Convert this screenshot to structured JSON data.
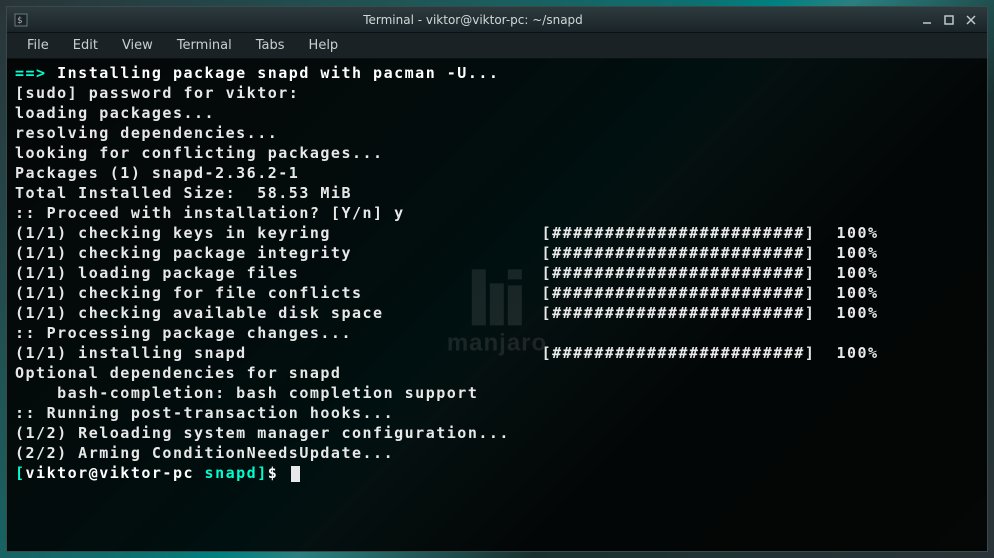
{
  "window": {
    "title": "Terminal - viktor@viktor-pc: ~/snapd"
  },
  "menubar": {
    "items": [
      "File",
      "Edit",
      "View",
      "Terminal",
      "Tabs",
      "Help"
    ]
  },
  "watermark": {
    "text": "manjaro"
  },
  "terminal": {
    "arrow": "==> ",
    "install_heading": "Installing package snapd with pacman -U...",
    "lines": [
      "[sudo] password for viktor:",
      "loading packages...",
      "resolving dependencies...",
      "looking for conflicting packages...",
      "",
      "Packages (1) snapd-2.36.2-1",
      "",
      "Total Installed Size:  58.53 MiB",
      "",
      ":: Proceed with installation? [Y/n] y"
    ],
    "progress": [
      {
        "label": "(1/1) checking keys in keyring",
        "pct": "100%"
      },
      {
        "label": "(1/1) checking package integrity",
        "pct": "100%"
      },
      {
        "label": "(1/1) loading package files",
        "pct": "100%"
      },
      {
        "label": "(1/1) checking for file conflicts",
        "pct": "100%"
      },
      {
        "label": "(1/1) checking available disk space",
        "pct": "100%"
      }
    ],
    "processing": ":: Processing package changes...",
    "install_progress": {
      "label": "(1/1) installing snapd",
      "pct": "100%"
    },
    "post": [
      "Optional dependencies for snapd",
      "    bash-completion: bash completion support",
      ":: Running post-transaction hooks...",
      "(1/2) Reloading system manager configuration...",
      "(2/2) Arming ConditionNeedsUpdate..."
    ],
    "bar": "[########################]",
    "prompt": {
      "open": "[",
      "user": "viktor@viktor-pc",
      "dir": " snapd",
      "close": "]",
      "dollar": "$ "
    }
  }
}
